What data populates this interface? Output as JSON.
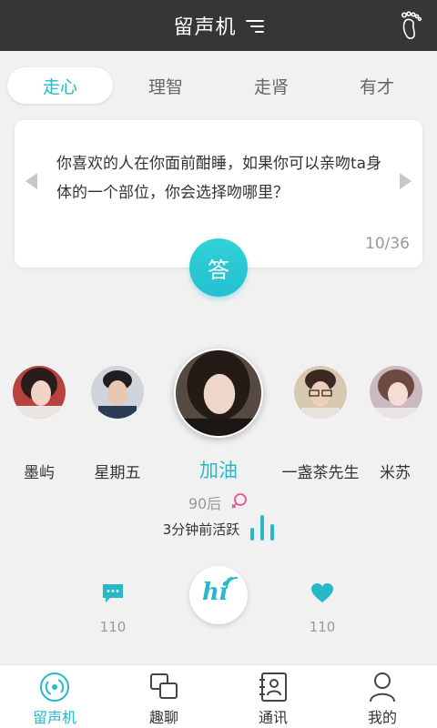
{
  "header": {
    "title": "留声机",
    "filter_icon": "filter-icon",
    "footprint_icon": "footprint-icon"
  },
  "tabs": [
    {
      "label": "走心",
      "active": true
    },
    {
      "label": "理智",
      "active": false
    },
    {
      "label": "走肾",
      "active": false
    },
    {
      "label": "有才",
      "active": false
    }
  ],
  "question": {
    "text": "你喜欢的人在你面前酣睡，如果你可以亲吻ta身体的一个部位，你会选择吻哪里？",
    "counter": "10/36",
    "answer_label": "答"
  },
  "users": [
    {
      "name": "墨屿"
    },
    {
      "name": "星期五"
    },
    {
      "name": "加油",
      "selected": true
    },
    {
      "name": "一盏茶先生"
    },
    {
      "name": "米苏"
    }
  ],
  "profile": {
    "age": "90后",
    "gender_icon": "female-icon",
    "active_status": "3分钟前活跃"
  },
  "actions": {
    "message_count": "110",
    "like_count": "110",
    "hi_label": "hi"
  },
  "bottom_nav": [
    {
      "label": "留声机",
      "icon": "gramophone-icon",
      "active": true
    },
    {
      "label": "趣聊",
      "icon": "chat-squares-icon",
      "active": false
    },
    {
      "label": "通讯",
      "icon": "contacts-icon",
      "active": false
    },
    {
      "label": "我的",
      "icon": "person-icon",
      "active": false
    }
  ],
  "colors": {
    "accent": "#27b9c9",
    "header_bg": "#363636",
    "gender": "#e8548a"
  }
}
